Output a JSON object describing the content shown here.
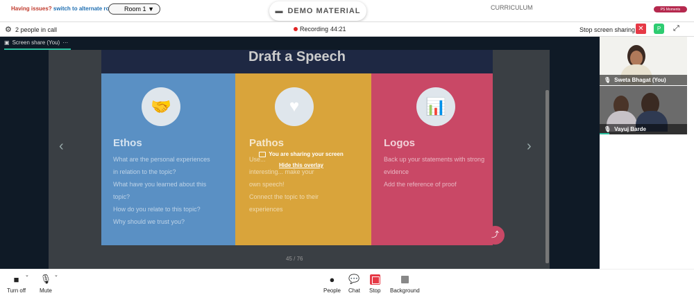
{
  "topbar": {
    "issues_text": "Having issues?",
    "switch_link": "switch to alternate room",
    "room_select": "Room 1",
    "demo_material": "DEMO MATERIAL",
    "curriculum": "CURRICULUM",
    "moments_badge": "PS Moments"
  },
  "callbar": {
    "people_count": "2 people in call",
    "recording_label": "Recording",
    "recording_time": "44:21",
    "stop_sharing": "Stop screen sharing",
    "avatar_letter": "P"
  },
  "tab": {
    "label": "Screen share (You)",
    "more": "···"
  },
  "slide": {
    "header": "Draft a Speech",
    "columns": [
      {
        "title": "Ethos",
        "icon": "handshake-icon",
        "lines": [
          "What are the personal experiences",
          "in relation to the topic?",
          "What have you learned about this",
          "topic?",
          "How do you relate to this topic?",
          "Why should we trust you?"
        ]
      },
      {
        "title": "Pathos",
        "icon": "heart-hands-icon",
        "lines": [
          "Use...",
          "interesting... make your",
          "own speech!",
          "Connect the topic to their",
          "experiences"
        ]
      },
      {
        "title": "Logos",
        "icon": "bar-chart-icon",
        "lines": [
          "Back up your statements with strong",
          "evidence",
          "Add the reference of proof"
        ]
      }
    ],
    "page": "45 / 76"
  },
  "overlay": {
    "message": "You are sharing your screen",
    "hide": "Hide this overlay"
  },
  "participants": [
    {
      "name": "Sweta Bhagat (You)"
    },
    {
      "name": "Vayuj Barde"
    }
  ],
  "controls": {
    "turn_off": "Turn off",
    "mute": "Mute",
    "people": "People",
    "chat": "Chat",
    "stop": "Stop",
    "background": "Background"
  },
  "colors": {
    "accent": "#2bbf9e",
    "danger": "#e63946",
    "ethos": "#5a90c4",
    "pathos": "#d9a43b",
    "logos": "#c94866"
  }
}
